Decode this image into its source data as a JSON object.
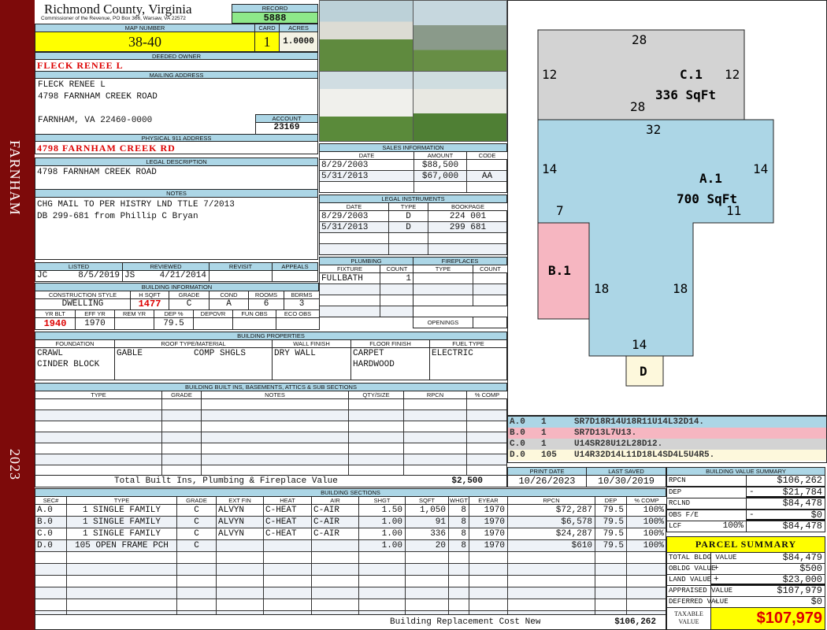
{
  "sidebar": {
    "district": "FARNHAM",
    "year": "2023"
  },
  "header": {
    "county": "Richmond County, Virginia",
    "subtitle": "Commissioner of the Revenue, PO Box 366, Warsaw, VA 22572",
    "record_label": "RECORD",
    "record": "5888"
  },
  "map": {
    "map_label": "MAP NUMBER",
    "map_number": "38-40",
    "card_label": "CARD",
    "card": "1",
    "acres_label": "ACRES",
    "acres": "1.0000"
  },
  "owner": {
    "label": "DEEDED OWNER",
    "name": "FLECK RENEE L"
  },
  "mailing": {
    "label": "MAILING ADDRESS",
    "line1": "FLECK RENEE L",
    "line2": "4798 FARNHAM CREEK ROAD",
    "line3": "FARNHAM, VA 22460-0000",
    "account_label": "ACCOUNT",
    "account": "23169"
  },
  "physical": {
    "label": "PHYSICAL 911 ADDRESS",
    "address": "4798 FARNHAM CREEK RD"
  },
  "legal": {
    "label": "LEGAL DESCRIPTION",
    "text": "4798 FARNHAM CREEK ROAD"
  },
  "notes": {
    "label": "NOTES",
    "line1": "CHG MAIL TO PER HISTRY LND TTLE 7/2013",
    "line2": "DB 299-681 from Phillip C Bryan"
  },
  "listing": {
    "headers": [
      "LISTED",
      "REVIEWED",
      "REVISIT",
      "APPEALS"
    ],
    "listed_by": "JC",
    "listed_date": "8/5/2019",
    "reviewed_by": "JS",
    "reviewed_date": "4/21/2014"
  },
  "building_info": {
    "label": "BUILDING INFORMATION",
    "headers1": [
      "CONSTRUCTION STYLE",
      "H SQFT",
      "GRADE",
      "COND",
      "ROOMS",
      "BDRMS"
    ],
    "values1": [
      "DWELLING",
      "1477",
      "C",
      "A",
      "6",
      "3"
    ],
    "headers2": [
      "YR BLT",
      "EFF YR",
      "REM YR",
      "DEP %",
      "DEPOVR",
      "FUN OBS",
      "ECO OBS"
    ],
    "values2": [
      "1940",
      "1970",
      "",
      "79.5",
      "",
      "",
      ""
    ]
  },
  "sales": {
    "label": "SALES INFORMATION",
    "headers": [
      "DATE",
      "AMOUNT",
      "CODE"
    ],
    "rows": [
      [
        "8/29/2003",
        "$88,500",
        ""
      ],
      [
        "5/31/2013",
        "$67,000",
        "AA"
      ],
      [
        "",
        "",
        ""
      ]
    ]
  },
  "instruments": {
    "label": "LEGAL INSTRUMENTS",
    "headers": [
      "DATE",
      "TYPE",
      "BOOKPAGE"
    ],
    "rows": [
      [
        "8/29/2003",
        "D",
        "224 001"
      ],
      [
        "5/31/2013",
        "D",
        "299 681"
      ],
      [
        "",
        "",
        ""
      ],
      [
        "",
        "",
        ""
      ]
    ]
  },
  "plumbing": {
    "label": "PLUMBING",
    "headers": [
      "FIXTURE",
      "COUNT"
    ],
    "rows": [
      [
        "FULLBATH",
        "1"
      ],
      [
        "",
        ""
      ],
      [
        "",
        ""
      ],
      [
        "",
        ""
      ]
    ]
  },
  "fireplaces": {
    "label": "FIREPLACES",
    "headers": [
      "TYPE",
      "COUNT"
    ],
    "rows": [
      [
        "",
        ""
      ],
      [
        "",
        ""
      ],
      [
        "",
        ""
      ]
    ],
    "openings_label": "OPENINGS"
  },
  "properties": {
    "label": "BUILDING PROPERTIES",
    "headers": [
      "FOUNDATION",
      "ROOF TYPE/MATERIAL",
      "WALL FINISH",
      "FLOOR FINISH",
      "FUEL TYPE"
    ],
    "foundation": [
      "CRAWL",
      "CINDER BLOCK"
    ],
    "roof_type": "GABLE",
    "roof_material": "COMP SHGLS",
    "wall": "DRY WALL",
    "floor": [
      "CARPET",
      "HARDWOOD"
    ],
    "fuel": "ELECTRIC"
  },
  "builtins": {
    "label": "BUILDING BUILT INS, BASEMENTS, ATTICS & SUB SECTIONS",
    "headers": [
      "TYPE",
      "GRADE",
      "NOTES",
      "QTY/SIZE",
      "RPCN",
      "% COMP"
    ],
    "rows": [
      [
        "",
        "",
        "",
        "",
        "",
        ""
      ],
      [
        "",
        "",
        "",
        "",
        "",
        ""
      ],
      [
        "",
        "",
        "",
        "",
        "",
        ""
      ],
      [
        "",
        "",
        "",
        "",
        "",
        ""
      ],
      [
        "",
        "",
        "",
        "",
        "",
        ""
      ],
      [
        "",
        "",
        "",
        "",
        "",
        ""
      ],
      [
        "",
        "",
        "",
        "",
        "",
        ""
      ]
    ],
    "total_label": "Total Built Ins, Plumbing & Fireplace Value",
    "total": "$2,500"
  },
  "sections": {
    "label": "BUILDING SECTIONS",
    "headers": [
      "SEC#",
      "TYPE",
      "GRADE",
      "EXT FIN",
      "HEAT",
      "AIR",
      "SHGT",
      "SQFT",
      "WHGT",
      "EYEAR",
      "RPCN",
      "DEP",
      "% COMP"
    ],
    "rows": [
      [
        "A.0",
        "1 SINGLE FAMILY",
        "C",
        "ALVYN",
        "C-HEAT",
        "C-AIR",
        "1.50",
        "1,050",
        "8",
        "1970",
        "$72,287",
        "79.5",
        "100%"
      ],
      [
        "B.0",
        "1 SINGLE FAMILY",
        "C",
        "ALVYN",
        "C-HEAT",
        "C-AIR",
        "1.00",
        "91",
        "8",
        "1970",
        "$6,578",
        "79.5",
        "100%"
      ],
      [
        "C.0",
        "1 SINGLE FAMILY",
        "C",
        "ALVYN",
        "C-HEAT",
        "C-AIR",
        "1.00",
        "336",
        "8",
        "1970",
        "$24,287",
        "79.5",
        "100%"
      ],
      [
        "D.0",
        "105 OPEN FRAME PCH",
        "C",
        "",
        "",
        "",
        "1.00",
        "20",
        "8",
        "1970",
        "$610",
        "79.5",
        "100%"
      ],
      [
        "",
        "",
        "",
        "",
        "",
        "",
        "",
        "",
        "",
        "",
        "",
        "",
        ""
      ],
      [
        "",
        "",
        "",
        "",
        "",
        "",
        "",
        "",
        "",
        "",
        "",
        "",
        ""
      ],
      [
        "",
        "",
        "",
        "",
        "",
        "",
        "",
        "",
        "",
        "",
        "",
        "",
        ""
      ],
      [
        "",
        "",
        "",
        "",
        "",
        "",
        "",
        "",
        "",
        "",
        "",
        "",
        ""
      ],
      [
        "",
        "",
        "",
        "",
        "",
        "",
        "",
        "",
        "",
        "",
        "",
        "",
        ""
      ],
      [
        "",
        "",
        "",
        "",
        "",
        "",
        "",
        "",
        "",
        "",
        "",
        "",
        ""
      ]
    ],
    "total_label": "Building Replacement Cost New",
    "total": "$106,262"
  },
  "sketch": {
    "labels": {
      "c_top": "28",
      "c_left": "12",
      "c_right": "12",
      "c_bottom": "28",
      "c_name": "C.1",
      "c_area": "336 SqFt",
      "a_top": "32",
      "a_left": "14",
      "a_right": "14",
      "a_name": "A.1",
      "a_area": "700 SqFt",
      "a_inner": "11",
      "a_step": "7",
      "a_l18": "18",
      "a_r18": "18",
      "a_bottom": "14",
      "b_name": "B.1",
      "d_name": "D"
    },
    "codes": [
      {
        "sec": "A.0",
        "code": "1",
        "path": "SR7D18R14U18R11U14L32D14.",
        "color": "#acd6e6"
      },
      {
        "sec": "B.0",
        "code": "1",
        "path": "SR7D13L7U13.",
        "color": "#f6b6c1"
      },
      {
        "sec": "C.0",
        "code": "1",
        "path": "U14SR28U12L28D12.",
        "color": "#d3d3d3"
      },
      {
        "sec": "D.0",
        "code": "105",
        "path": "U14R32D14L11D18L4SD4L5U4R5.",
        "color": "#fdf8dc"
      }
    ]
  },
  "dates": {
    "print_label": "PRINT DATE",
    "print": "10/26/2023",
    "saved_label": "LAST SAVED",
    "saved": "10/30/2019"
  },
  "value_summary": {
    "label": "BUILDING VALUE SUMMARY",
    "rows": [
      {
        "label": "RPCN",
        "sign": "",
        "value": "$106,262"
      },
      {
        "label": "DEP",
        "sign": "-",
        "value": "$21,784"
      },
      {
        "label": "RCLND",
        "sign": "",
        "value": "$84,478"
      },
      {
        "label": "OBS F/E",
        "sign": "-",
        "value": "$0"
      },
      {
        "label": "LCF",
        "pct": "100%",
        "sign": "",
        "value": "$84,478"
      }
    ]
  },
  "parcel": {
    "label": "PARCEL SUMMARY",
    "rows": [
      {
        "label": "TOTAL BLDG VALUE",
        "sign": "",
        "value": "$84,479"
      },
      {
        "label": "OBLDG VALUE",
        "sign": "+",
        "value": "$500"
      },
      {
        "label": "LAND VALUE",
        "sign": "+",
        "value": "$23,000"
      },
      {
        "label": "APPRAISED VALUE",
        "sign": "",
        "value": "$107,979"
      },
      {
        "label": "DEFERRED VALUE",
        "sign": "-",
        "value": "$0"
      }
    ],
    "taxable_label1": "TAXABLE",
    "taxable_label2": "VALUE",
    "taxable": "$107,979"
  }
}
